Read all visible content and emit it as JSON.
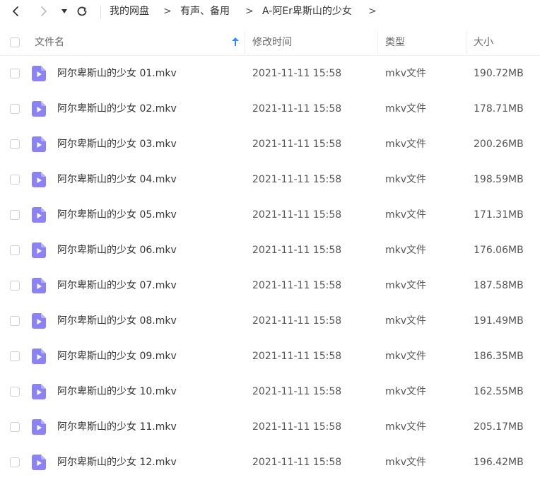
{
  "toolbar": {
    "breadcrumbs": [
      "我的网盘",
      "有声、备用",
      "A-阿Er卑斯山的少女"
    ],
    "separator": ">"
  },
  "columns": {
    "name": "文件名",
    "time": "修改时间",
    "type": "类型",
    "size": "大小"
  },
  "files": [
    {
      "name": "阿尔卑斯山的少女 01.mkv",
      "time": "2021-11-11 15:58",
      "type": "mkv文件",
      "size": "190.72MB"
    },
    {
      "name": "阿尔卑斯山的少女 02.mkv",
      "time": "2021-11-11 15:58",
      "type": "mkv文件",
      "size": "178.71MB"
    },
    {
      "name": "阿尔卑斯山的少女 03.mkv",
      "time": "2021-11-11 15:58",
      "type": "mkv文件",
      "size": "200.26MB"
    },
    {
      "name": "阿尔卑斯山的少女 04.mkv",
      "time": "2021-11-11 15:58",
      "type": "mkv文件",
      "size": "198.59MB"
    },
    {
      "name": "阿尔卑斯山的少女 05.mkv",
      "time": "2021-11-11 15:58",
      "type": "mkv文件",
      "size": "171.31MB"
    },
    {
      "name": "阿尔卑斯山的少女 06.mkv",
      "time": "2021-11-11 15:58",
      "type": "mkv文件",
      "size": "176.06MB"
    },
    {
      "name": "阿尔卑斯山的少女 07.mkv",
      "time": "2021-11-11 15:58",
      "type": "mkv文件",
      "size": "187.58MB"
    },
    {
      "name": "阿尔卑斯山的少女 08.mkv",
      "time": "2021-11-11 15:58",
      "type": "mkv文件",
      "size": "191.49MB"
    },
    {
      "name": "阿尔卑斯山的少女 09.mkv",
      "time": "2021-11-11 15:58",
      "type": "mkv文件",
      "size": "186.35MB"
    },
    {
      "name": "阿尔卑斯山的少女 10.mkv",
      "time": "2021-11-11 15:58",
      "type": "mkv文件",
      "size": "162.55MB"
    },
    {
      "name": "阿尔卑斯山的少女 11.mkv",
      "time": "2021-11-11 15:58",
      "type": "mkv文件",
      "size": "205.17MB"
    },
    {
      "name": "阿尔卑斯山的少女 12.mkv",
      "time": "2021-11-11 15:58",
      "type": "mkv文件",
      "size": "196.42MB"
    }
  ],
  "icons": {
    "back": "chevron-left-icon",
    "forward": "chevron-right-icon",
    "history": "caret-down-icon",
    "refresh": "refresh-icon",
    "sort": "sort-ascending-icon",
    "file": "video-file-icon"
  },
  "colors": {
    "file_icon": "#8b82f6",
    "sort_arrow": "#2f8cff"
  }
}
